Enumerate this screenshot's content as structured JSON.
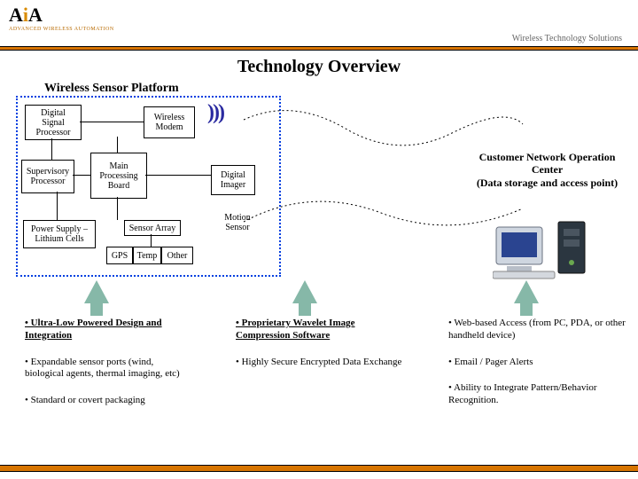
{
  "header": {
    "brand_a": "A",
    "brand_i": "i",
    "brand_a2": "A",
    "brand_sub": "ADVANCED WIRELESS AUTOMATION",
    "right": "Wireless Technology Solutions"
  },
  "title": "Technology Overview",
  "subheader": "Wireless Sensor Platform",
  "blocks": {
    "dsp": "Digital\nSignal\nProcessor",
    "modem": "Wireless\nModem",
    "sup": "Supervisory\nProcessor",
    "mpb": "Main\nProcessing\nBoard",
    "imager": "Digital\nImager",
    "psu": "Power Supply –\nLithium Cells",
    "sarr": "Sensor Array",
    "gps": "GPS",
    "temp": "Temp",
    "other": "Other",
    "motion": "Motion\nSensor"
  },
  "waves": ")))",
  "cnoc": "Customer Network Operation Center\n(Data storage and access point)",
  "col1": {
    "b1": "• Ultra-Low Powered Design and Integration",
    "b2": "• Expandable sensor ports (wind, biological agents, thermal imaging, etc)",
    "b3": "• Standard or covert packaging"
  },
  "col2": {
    "b1": "• Proprietary Wavelet Image Compression Software",
    "b2": "• Highly Secure Encrypted Data Exchange"
  },
  "col3": {
    "b1": "• Web-based Access (from PC, PDA, or other handheld device)",
    "b2": "• Email / Pager Alerts",
    "b3": "• Ability to Integrate Pattern/Behavior Recognition."
  }
}
